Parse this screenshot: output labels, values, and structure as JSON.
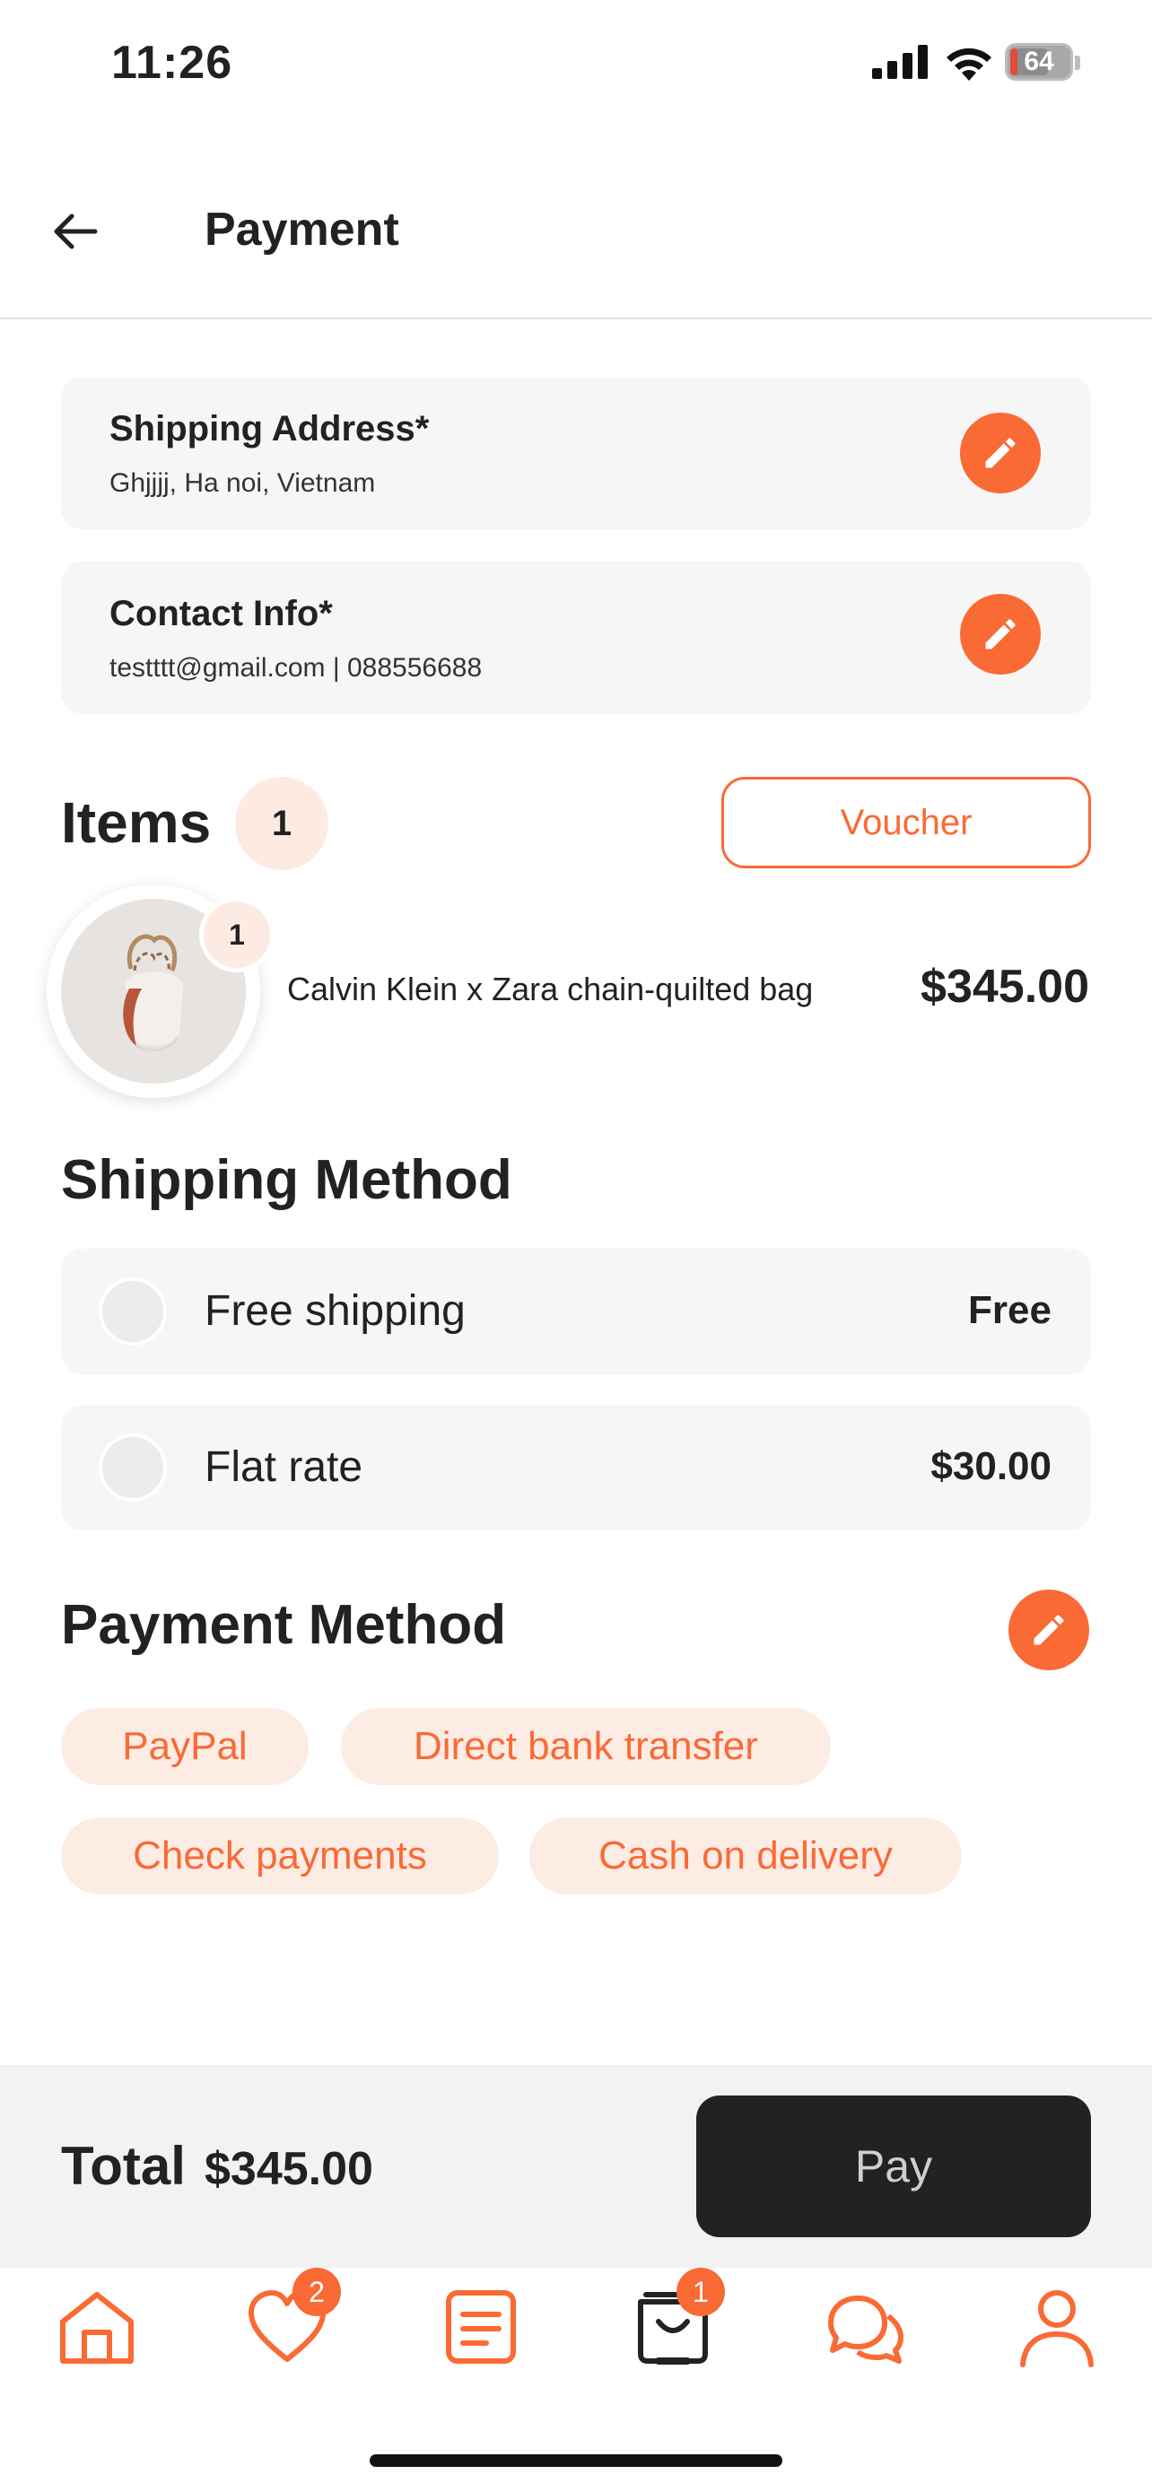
{
  "status_bar": {
    "time": "11:26",
    "battery": "64"
  },
  "header": {
    "title": "Payment"
  },
  "shipping_address": {
    "title": "Shipping Address*",
    "value": "Ghjjjj, Ha noi, Vietnam"
  },
  "contact_info": {
    "title": "Contact Info*",
    "value": "testttt@gmail.com | 088556688"
  },
  "items": {
    "title": "Items",
    "count": "1",
    "voucher_label": "Voucher",
    "list": [
      {
        "name": "Calvin Klein x Zara chain-quilted bag",
        "price": "$345.00",
        "qty": "1"
      }
    ]
  },
  "shipping_method": {
    "title": "Shipping Method",
    "options": [
      {
        "label": "Free shipping",
        "price": "Free"
      },
      {
        "label": "Flat rate",
        "price": "$30.00"
      }
    ]
  },
  "payment_method": {
    "title": "Payment Method",
    "options": [
      "PayPal",
      "Direct bank transfer",
      "Check payments",
      "Cash on delivery"
    ]
  },
  "footer": {
    "total_label": "Total",
    "total_value": "$345.00",
    "pay_label": "Pay"
  },
  "tab_bar": {
    "items": [
      {
        "icon": "home-icon"
      },
      {
        "icon": "heart-icon",
        "badge": "2"
      },
      {
        "icon": "orders-icon"
      },
      {
        "icon": "cart-icon",
        "badge": "1"
      },
      {
        "icon": "chat-icon"
      },
      {
        "icon": "profile-icon"
      }
    ]
  },
  "colors": {
    "accent": "#fa6a35",
    "accent_light": "#fdece4",
    "dark": "#222222",
    "card_bg": "#f6f6f6"
  }
}
